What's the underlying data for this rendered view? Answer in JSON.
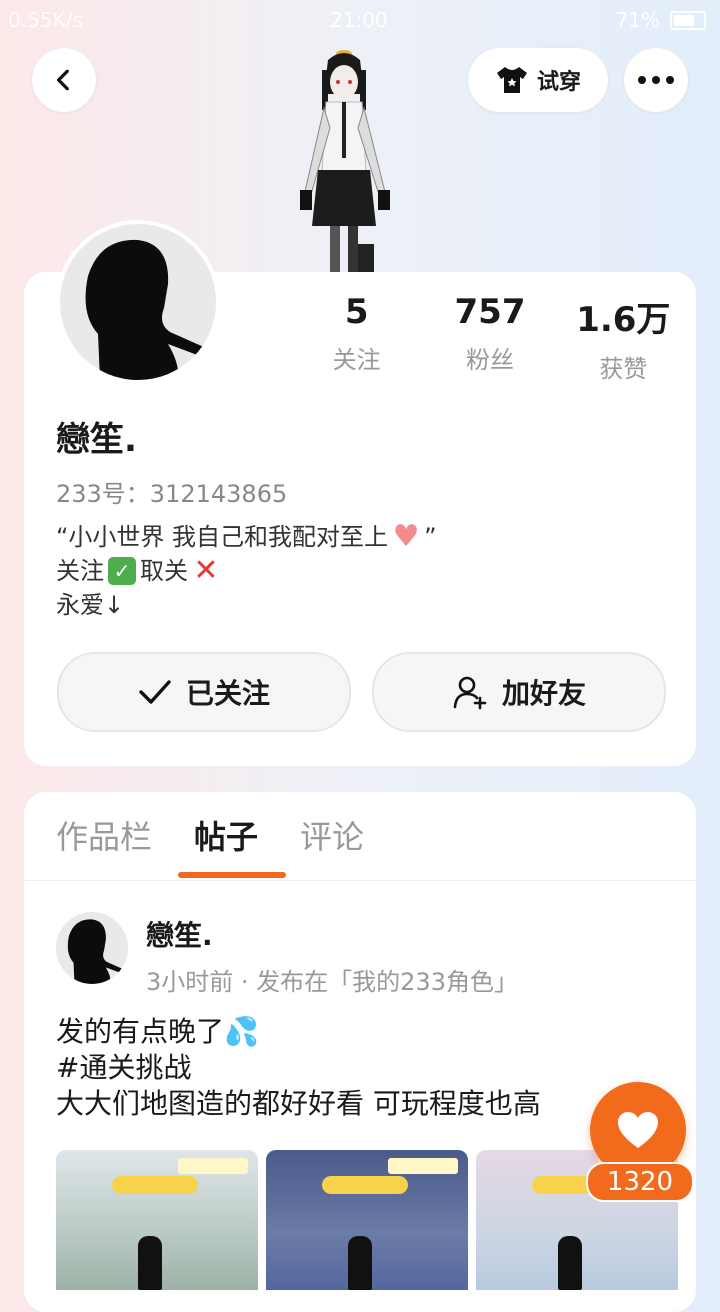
{
  "status_bar": {
    "net": "0.55K/s",
    "time": "21:00",
    "battery": "71%"
  },
  "header": {
    "tryon_label": "试穿"
  },
  "profile": {
    "stats": [
      {
        "value": "5",
        "label": "关注"
      },
      {
        "value": "757",
        "label": "粉丝"
      },
      {
        "value": "1.6万",
        "label": "获赞"
      }
    ],
    "username": "戀笙.",
    "uid": "233号：312143865",
    "bio_line1": "“小小世界 我自己和我配对至上",
    "bio_line1_end": "”",
    "bio_line2a": "关注",
    "bio_line2b": " 取关",
    "bio_line3": "永爱↓",
    "followed_label": "已关注",
    "add_friend_label": "加好友"
  },
  "tabs": [
    "作品栏",
    "帖子",
    "评论"
  ],
  "post": {
    "author": "戀笙.",
    "meta": "3小时前 · 发布在「我的233角色」",
    "line1": "发的有点晚了",
    "line2": "#通关挑战",
    "line3": "大大们地图造的都好好看 可玩程度也高"
  },
  "likes": {
    "count": "1320"
  },
  "colors": {
    "accent": "#f26b1d"
  }
}
